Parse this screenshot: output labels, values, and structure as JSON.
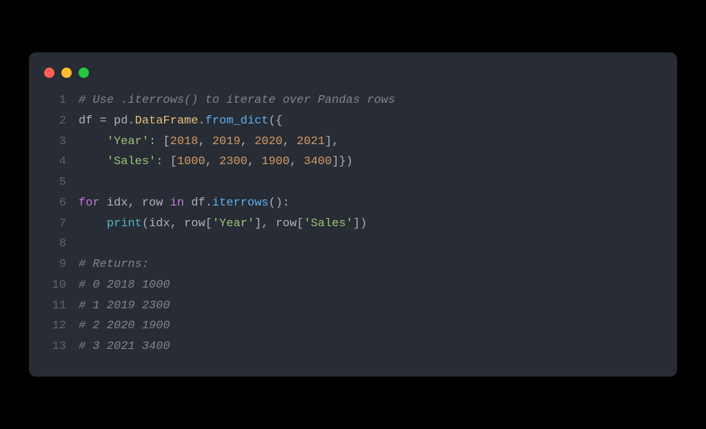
{
  "window": {
    "dots": [
      "red",
      "yellow",
      "green"
    ]
  },
  "code": {
    "lines": [
      {
        "n": "1",
        "tokens": [
          {
            "cls": "comment",
            "t": "# Use .iterrows() to iterate over Pandas rows"
          }
        ]
      },
      {
        "n": "2",
        "tokens": [
          {
            "cls": "variable",
            "t": "df "
          },
          {
            "cls": "operator",
            "t": "= "
          },
          {
            "cls": "variable",
            "t": "pd"
          },
          {
            "cls": "operator",
            "t": "."
          },
          {
            "cls": "prop",
            "t": "DataFrame"
          },
          {
            "cls": "operator",
            "t": "."
          },
          {
            "cls": "method",
            "t": "from_dict"
          },
          {
            "cls": "bracket",
            "t": "({"
          }
        ]
      },
      {
        "n": "3",
        "tokens": [
          {
            "cls": "variable",
            "t": "    "
          },
          {
            "cls": "string",
            "t": "'Year'"
          },
          {
            "cls": "operator",
            "t": ": "
          },
          {
            "cls": "bracket",
            "t": "["
          },
          {
            "cls": "number",
            "t": "2018"
          },
          {
            "cls": "operator",
            "t": ", "
          },
          {
            "cls": "number",
            "t": "2019"
          },
          {
            "cls": "operator",
            "t": ", "
          },
          {
            "cls": "number",
            "t": "2020"
          },
          {
            "cls": "operator",
            "t": ", "
          },
          {
            "cls": "number",
            "t": "2021"
          },
          {
            "cls": "bracket",
            "t": "]"
          },
          {
            "cls": "operator",
            "t": ","
          }
        ]
      },
      {
        "n": "4",
        "tokens": [
          {
            "cls": "variable",
            "t": "    "
          },
          {
            "cls": "string",
            "t": "'Sales'"
          },
          {
            "cls": "operator",
            "t": ": "
          },
          {
            "cls": "bracket",
            "t": "["
          },
          {
            "cls": "number",
            "t": "1000"
          },
          {
            "cls": "operator",
            "t": ", "
          },
          {
            "cls": "number",
            "t": "2300"
          },
          {
            "cls": "operator",
            "t": ", "
          },
          {
            "cls": "number",
            "t": "1900"
          },
          {
            "cls": "operator",
            "t": ", "
          },
          {
            "cls": "number",
            "t": "3400"
          },
          {
            "cls": "bracket",
            "t": "]})"
          }
        ]
      },
      {
        "n": "5",
        "tokens": []
      },
      {
        "n": "6",
        "tokens": [
          {
            "cls": "keyword",
            "t": "for"
          },
          {
            "cls": "variable",
            "t": " idx"
          },
          {
            "cls": "operator",
            "t": ", "
          },
          {
            "cls": "variable",
            "t": "row "
          },
          {
            "cls": "keyword",
            "t": "in"
          },
          {
            "cls": "variable",
            "t": " df"
          },
          {
            "cls": "operator",
            "t": "."
          },
          {
            "cls": "method",
            "t": "iterrows"
          },
          {
            "cls": "bracket",
            "t": "()"
          },
          {
            "cls": "operator",
            "t": ":"
          }
        ]
      },
      {
        "n": "7",
        "tokens": [
          {
            "cls": "variable",
            "t": "    "
          },
          {
            "cls": "builtin",
            "t": "print"
          },
          {
            "cls": "bracket",
            "t": "("
          },
          {
            "cls": "variable",
            "t": "idx"
          },
          {
            "cls": "operator",
            "t": ", "
          },
          {
            "cls": "variable",
            "t": "row"
          },
          {
            "cls": "bracket",
            "t": "["
          },
          {
            "cls": "string",
            "t": "'Year'"
          },
          {
            "cls": "bracket",
            "t": "]"
          },
          {
            "cls": "operator",
            "t": ", "
          },
          {
            "cls": "variable",
            "t": "row"
          },
          {
            "cls": "bracket",
            "t": "["
          },
          {
            "cls": "string",
            "t": "'Sales'"
          },
          {
            "cls": "bracket",
            "t": "])"
          }
        ]
      },
      {
        "n": "8",
        "tokens": []
      },
      {
        "n": "9",
        "tokens": [
          {
            "cls": "comment",
            "t": "# Returns:"
          }
        ]
      },
      {
        "n": "10",
        "tokens": [
          {
            "cls": "comment",
            "t": "# 0 2018 1000"
          }
        ]
      },
      {
        "n": "11",
        "tokens": [
          {
            "cls": "comment",
            "t": "# 1 2019 2300"
          }
        ]
      },
      {
        "n": "12",
        "tokens": [
          {
            "cls": "comment",
            "t": "# 2 2020 1900"
          }
        ]
      },
      {
        "n": "13",
        "tokens": [
          {
            "cls": "comment",
            "t": "# 3 2021 3400"
          }
        ]
      }
    ]
  }
}
